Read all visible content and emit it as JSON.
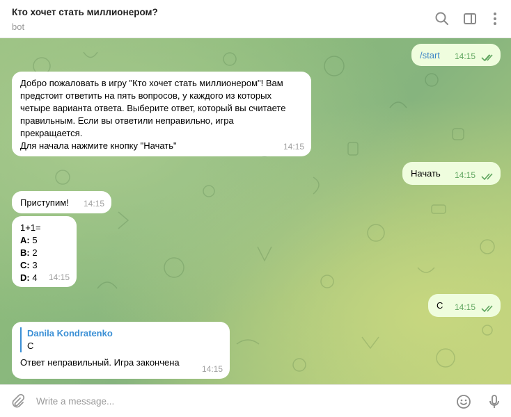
{
  "header": {
    "title": "Кто хочет стать миллионером?",
    "subtitle": "bot"
  },
  "messages": [
    {
      "from": "me",
      "text": "/start",
      "time": "14:15"
    },
    {
      "from": "bot",
      "text": "Добро пожаловать в игру \"Кто хочет стать миллионером\"! Вам\nпредстоит ответить на пять вопросов, у каждого из которых\nчетыре варианта ответа. Выберите ответ, который вы считаете\nправильным. Если вы ответили неправильно, игра\nпрекращается.\nДля начала нажмите кнопку \"Начать\"",
      "time": "14:15"
    },
    {
      "from": "me",
      "text": "Начать",
      "time": "14:15"
    },
    {
      "from": "bot",
      "text": "Приступим!",
      "time": "14:15"
    },
    {
      "from": "bot",
      "question": "1+1=",
      "options": [
        {
          "key": "A:",
          "value": "5"
        },
        {
          "key": "B:",
          "value": "2"
        },
        {
          "key": "C:",
          "value": "3"
        },
        {
          "key": "D:",
          "value": "4"
        }
      ],
      "time": "14:15"
    },
    {
      "from": "me",
      "text": "C",
      "time": "14:15"
    },
    {
      "from": "bot",
      "reply_to": {
        "name": "Danila Kondratenko",
        "text": "C"
      },
      "text": "Ответ неправильный. Игра закончена",
      "time": "14:15"
    }
  ],
  "composer": {
    "placeholder": "Write a message..."
  },
  "colors": {
    "accent": "#3a8fd5",
    "out_bubble": "#effdde",
    "check": "#5ea55e"
  }
}
